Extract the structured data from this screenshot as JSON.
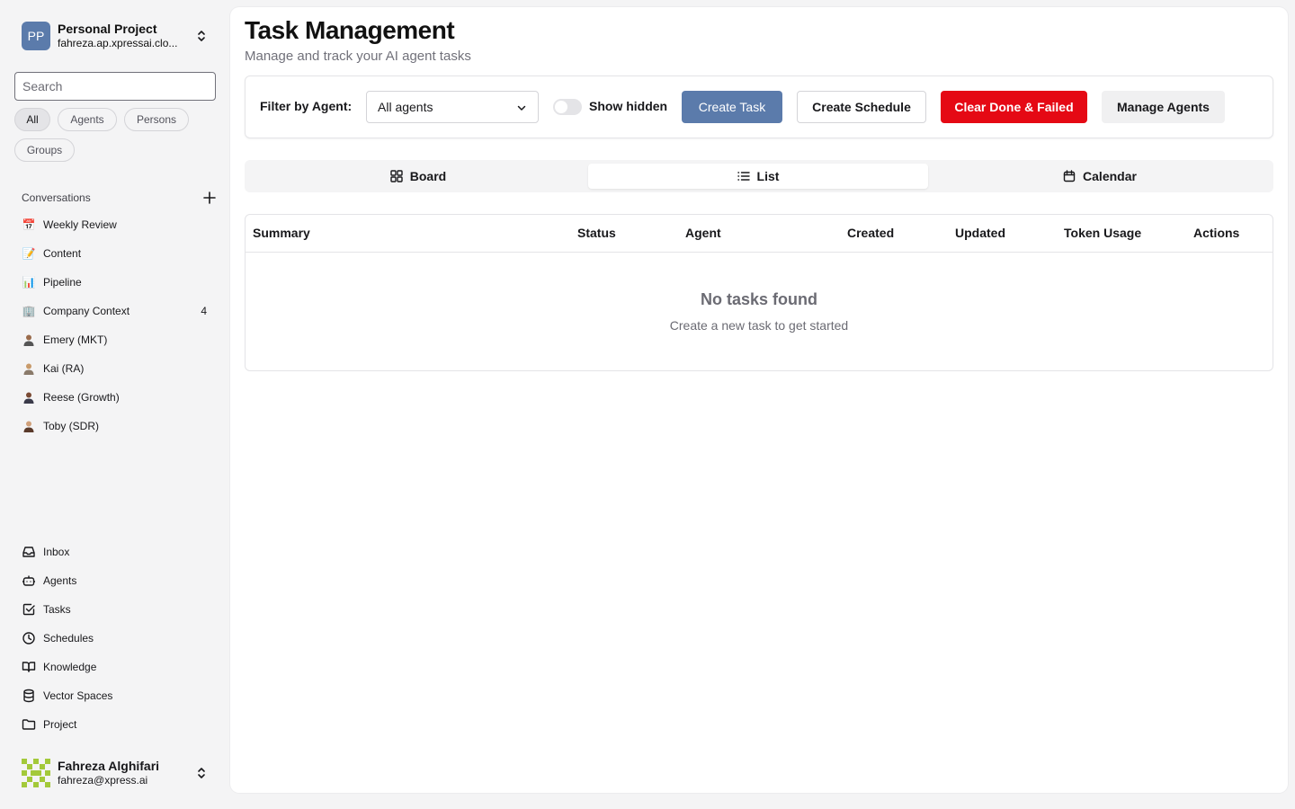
{
  "project": {
    "initials": "PP",
    "name": "Personal Project",
    "account": "fahreza.ap.xpressai.clo..."
  },
  "search": {
    "placeholder": "Search"
  },
  "filters": [
    "All",
    "Agents",
    "Persons",
    "Groups"
  ],
  "conversations": {
    "heading": "Conversations",
    "items": [
      {
        "icon": "calendar-emoji-icon",
        "glyph": "📅",
        "label": "Weekly Review"
      },
      {
        "icon": "memo-emoji-icon",
        "glyph": "📝",
        "label": "Content"
      },
      {
        "icon": "bar-chart-emoji-icon",
        "glyph": "📊",
        "label": "Pipeline"
      },
      {
        "icon": "office-building-emoji-icon",
        "glyph": "🏢",
        "label": "Company Context",
        "badge": "4"
      },
      {
        "icon": "person-avatar-icon",
        "label": "Emery (MKT)"
      },
      {
        "icon": "person-avatar-icon",
        "label": "Kai (RA)"
      },
      {
        "icon": "person-avatar-icon",
        "label": "Reese (Growth)"
      },
      {
        "icon": "person-avatar-icon",
        "label": "Toby (SDR)"
      }
    ]
  },
  "nav": [
    {
      "icon": "inbox-icon",
      "label": "Inbox"
    },
    {
      "icon": "bot-icon",
      "label": "Agents"
    },
    {
      "icon": "check-square-icon",
      "label": "Tasks"
    },
    {
      "icon": "clock-icon",
      "label": "Schedules"
    },
    {
      "icon": "book-icon",
      "label": "Knowledge"
    },
    {
      "icon": "database-icon",
      "label": "Vector Spaces"
    },
    {
      "icon": "folder-icon",
      "label": "Project"
    }
  ],
  "user": {
    "name": "Fahreza Alghifari",
    "email": "fahreza@xpress.ai"
  },
  "page": {
    "title": "Task Management",
    "subtitle": "Manage and track your AI agent tasks"
  },
  "toolbar": {
    "filter_label": "Filter by Agent:",
    "agent_select": "All agents",
    "show_hidden_label": "Show hidden",
    "show_hidden": false,
    "create_task": "Create Task",
    "create_schedule": "Create Schedule",
    "clear_done": "Clear Done & Failed",
    "manage_agents": "Manage Agents"
  },
  "views": {
    "board": "Board",
    "list": "List",
    "calendar": "Calendar",
    "active": "List"
  },
  "table": {
    "columns": [
      "Summary",
      "Status",
      "Agent",
      "Created",
      "Updated",
      "Token Usage",
      "Actions"
    ],
    "rows": [],
    "empty_title": "No tasks found",
    "empty_subtitle": "Create a new task to get started"
  },
  "colors": {
    "primary": "#5b7bab",
    "danger": "#e50914",
    "sidebar_bg": "#f4f4f5"
  }
}
